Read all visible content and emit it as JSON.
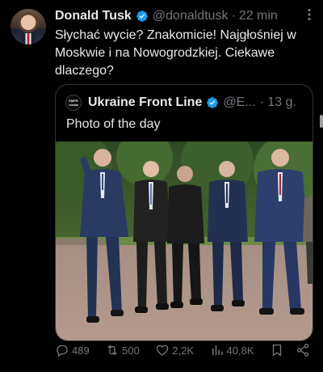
{
  "tweet": {
    "author_name": "Donald Tusk",
    "author_handle": "@donaldtusk",
    "separator": "·",
    "time": "22 min",
    "more_label": "⋮",
    "text": "Słychać wycie? Znakomicie! Najgłośniej w Moskwie i na Nowogrodzkiej. Ciekawe dlaczego?"
  },
  "quote": {
    "logo_text_top": "EMPR",
    "logo_text_bottom": "media",
    "author_name": "Ukraine Front Line",
    "author_handle": "@E...",
    "time": "· 13 g.",
    "text": "Photo of the day"
  },
  "actions": {
    "replies": "489",
    "reposts": "500",
    "likes": "2,2K",
    "views": "40,8K"
  },
  "colors": {
    "background": "#000000",
    "text": "#e7e9ea",
    "muted": "#71767b",
    "verified_blue": "#1d9bf0",
    "border": "#2f3336"
  },
  "icons": [
    "verified-icon",
    "more-icon",
    "reply-icon",
    "repost-icon",
    "like-icon",
    "views-icon",
    "bookmark-icon",
    "share-icon"
  ]
}
